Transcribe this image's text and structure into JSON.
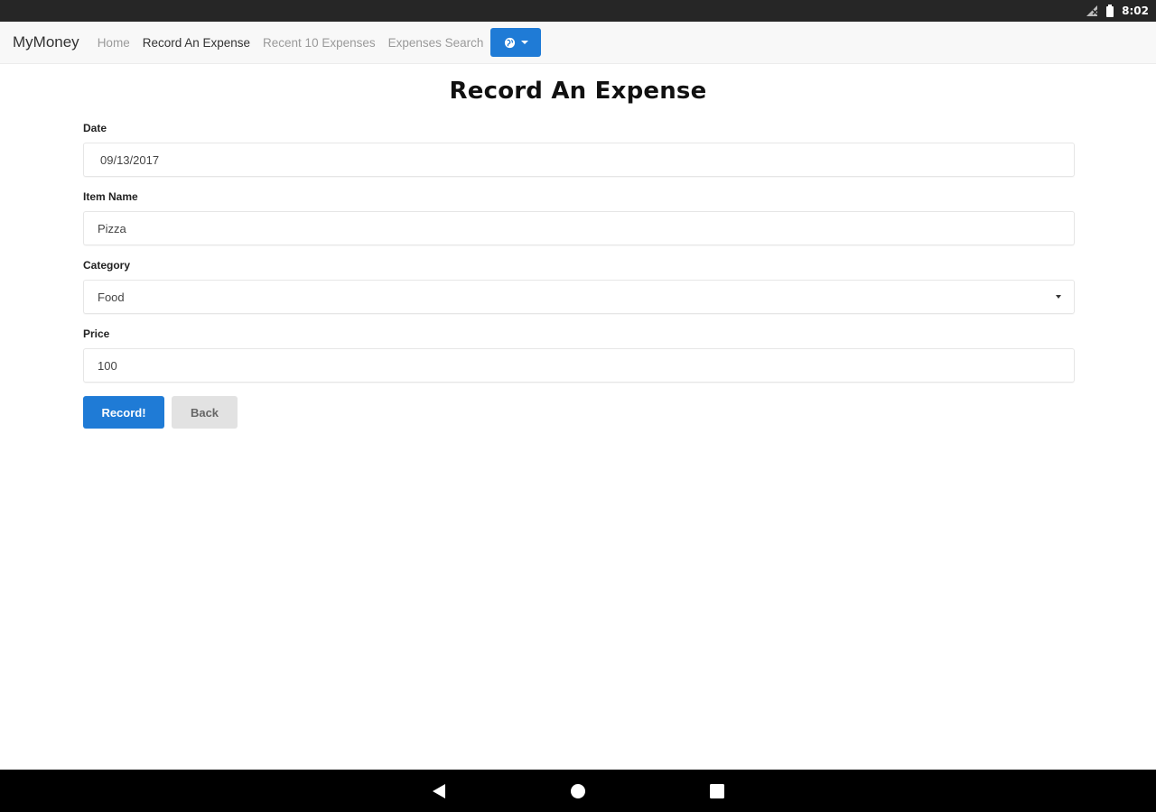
{
  "status_bar": {
    "time": "8:02",
    "icons": [
      "signal-icon",
      "battery-icon"
    ]
  },
  "navbar": {
    "brand": "MyMoney",
    "links": [
      {
        "label": "Home",
        "active": false
      },
      {
        "label": "Record An Expense",
        "active": true
      },
      {
        "label": "Recent 10 Expenses",
        "active": false
      },
      {
        "label": "Expenses Search",
        "active": false
      }
    ],
    "dropdown_icon": "globe-icon",
    "dropdown_color": "#1f7bd6"
  },
  "page": {
    "title": "Record An Expense"
  },
  "form": {
    "date": {
      "label": "Date",
      "value": "09/13/2017"
    },
    "item_name": {
      "label": "Item Name",
      "value": "Pizza"
    },
    "category": {
      "label": "Category",
      "selected": "Food"
    },
    "price": {
      "label": "Price",
      "value": "100"
    },
    "submit_label": "Record!",
    "back_label": "Back"
  },
  "system_nav": {
    "buttons": [
      "back-icon",
      "home-icon",
      "recents-icon"
    ]
  }
}
